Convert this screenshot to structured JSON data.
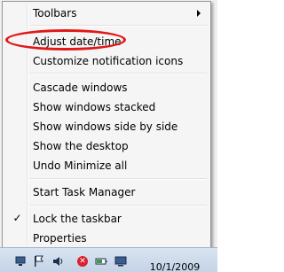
{
  "menu": {
    "items": [
      {
        "label": "Toolbars"
      },
      {
        "label": "Adjust date/time"
      },
      {
        "label": "Customize notification icons"
      },
      {
        "label": "Cascade windows"
      },
      {
        "label": "Show windows stacked"
      },
      {
        "label": "Show windows side by side"
      },
      {
        "label": "Show the desktop"
      },
      {
        "label": "Undo Minimize all"
      },
      {
        "label": "Start Task Manager"
      },
      {
        "label": "Lock the taskbar"
      },
      {
        "label": "Properties"
      }
    ]
  },
  "annotation": {
    "color": "#e01818"
  },
  "taskbar": {
    "tray_icons": [
      "network-icon",
      "flag-icon",
      "volume-icon",
      "security-icon",
      "battery-icon",
      "display-icon"
    ],
    "date": "10/1/2009"
  }
}
